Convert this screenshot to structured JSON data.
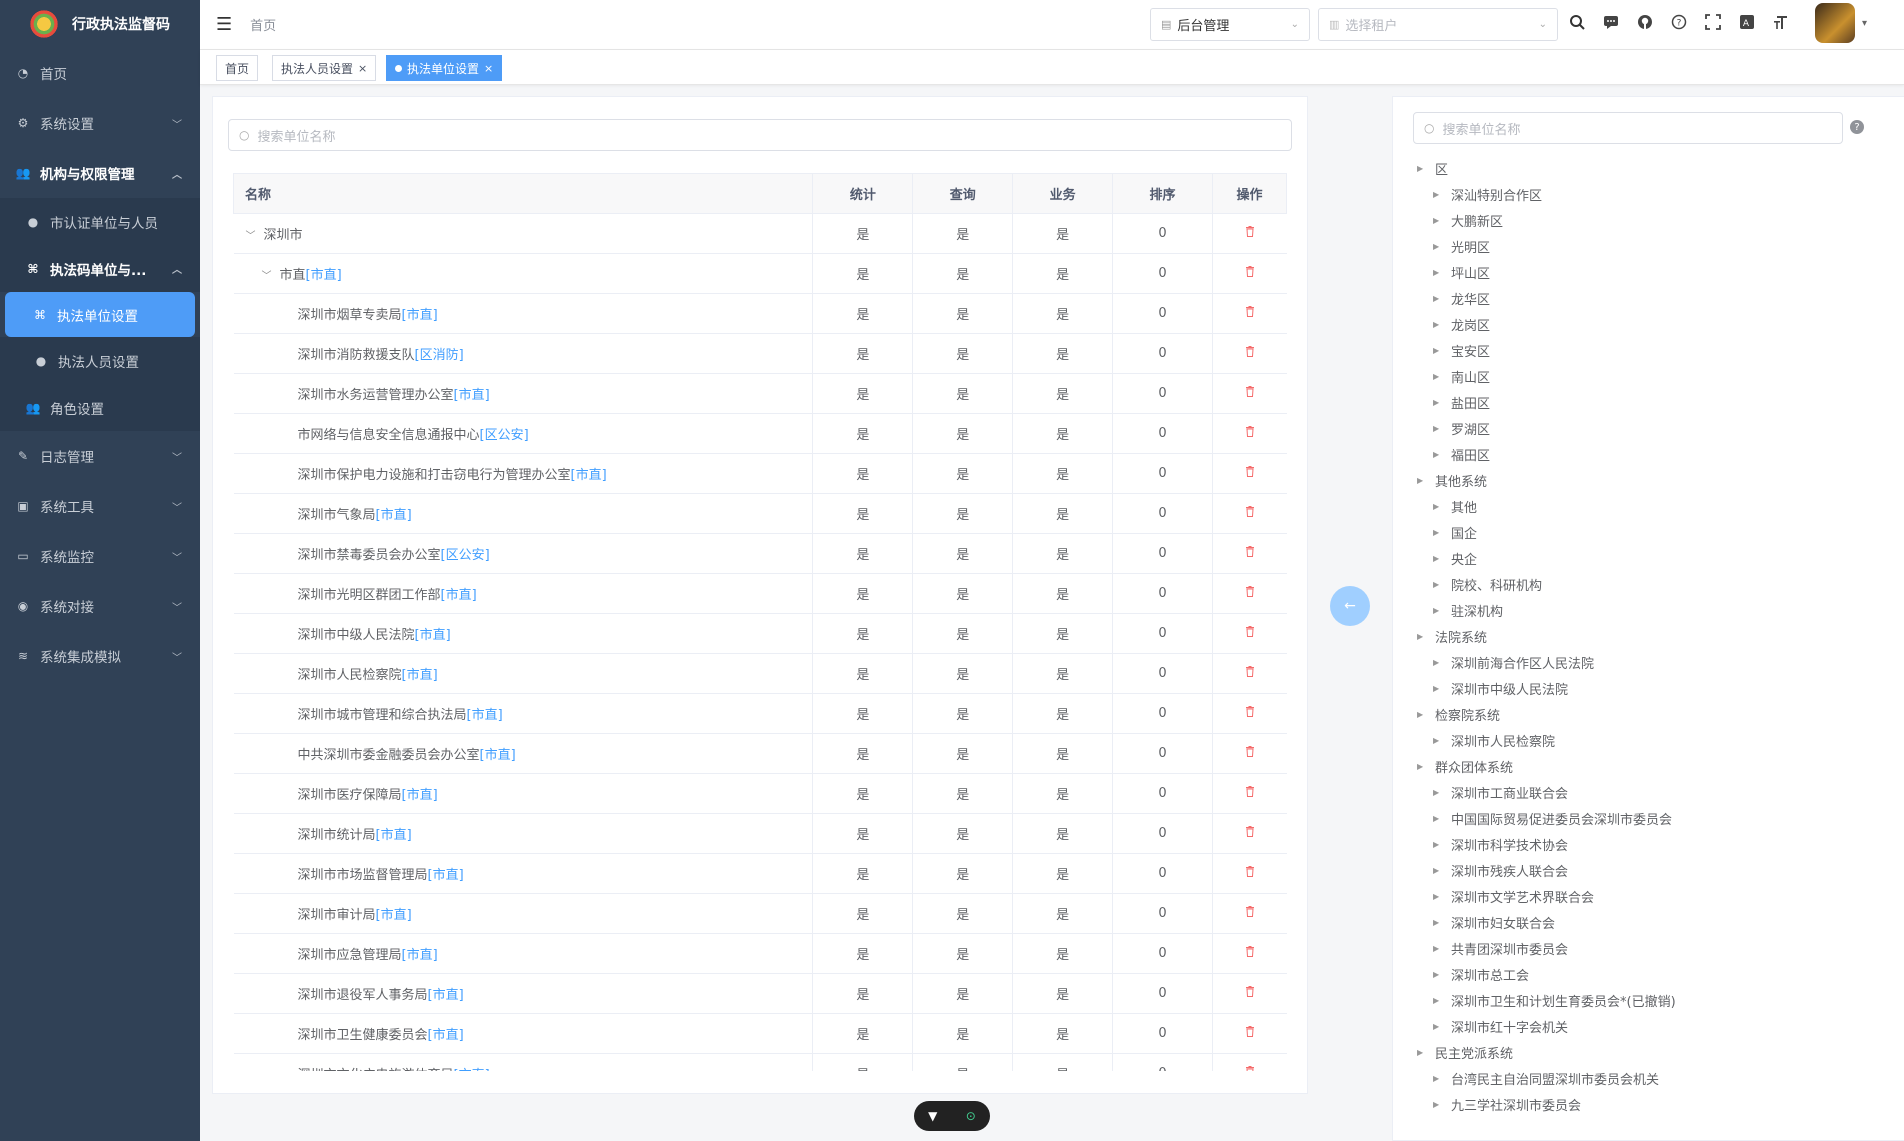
{
  "app": {
    "title": "行政执法监督码"
  },
  "sidebar": {
    "items": [
      {
        "label": "首页",
        "icon": "dashboard-icon",
        "type": "top"
      },
      {
        "label": "系统设置",
        "icon": "gear-icon",
        "type": "top",
        "chev": "down"
      },
      {
        "label": "机构与权限管理",
        "icon": "users-icon",
        "type": "top",
        "chev": "up",
        "bold": true
      },
      {
        "label": "市认证单位与人员",
        "icon": "user-icon",
        "type": "sub"
      },
      {
        "label": "执法码单位与...",
        "icon": "tree-icon",
        "type": "sub",
        "chev": "up",
        "bold": true
      },
      {
        "label": "执法单位设置",
        "icon": "tree-icon",
        "type": "active"
      },
      {
        "label": "执法人员设置",
        "icon": "user-icon",
        "type": "sub2"
      },
      {
        "label": "角色设置",
        "icon": "users-icon",
        "type": "sub"
      },
      {
        "label": "日志管理",
        "icon": "edit-icon",
        "type": "top",
        "chev": "down"
      },
      {
        "label": "系统工具",
        "icon": "briefcase-icon",
        "type": "top",
        "chev": "down"
      },
      {
        "label": "系统监控",
        "icon": "monitor-icon",
        "type": "top",
        "chev": "down"
      },
      {
        "label": "系统对接",
        "icon": "globe-icon",
        "type": "top",
        "chev": "down"
      },
      {
        "label": "系统集成模拟",
        "icon": "layers-icon",
        "type": "top",
        "chev": "down"
      }
    ]
  },
  "header": {
    "breadcrumb": "首页",
    "backend_select": "后台管理",
    "tenant_placeholder": "选择租户"
  },
  "tags": [
    {
      "label": "首页",
      "active": false,
      "closable": false
    },
    {
      "label": "执法人员设置",
      "active": false,
      "closable": true
    },
    {
      "label": "执法单位设置",
      "active": true,
      "closable": true
    }
  ],
  "left": {
    "search_placeholder": "搜索单位名称",
    "columns": [
      "名称",
      "统计",
      "查询",
      "业务",
      "排序",
      "操作"
    ],
    "rows": [
      {
        "name": "深圳市",
        "suffix": "",
        "level": 0,
        "expand": true,
        "stat": "是",
        "query": "是",
        "biz": "是",
        "sort": "0"
      },
      {
        "name": "市直",
        "suffix": "[市直]",
        "level": 1,
        "expand": true,
        "stat": "是",
        "query": "是",
        "biz": "是",
        "sort": "0"
      },
      {
        "name": "深圳市烟草专卖局",
        "suffix": "[市直]",
        "level": 2,
        "stat": "是",
        "query": "是",
        "biz": "是",
        "sort": "0"
      },
      {
        "name": "深圳市消防救援支队",
        "suffix": "[区消防]",
        "level": 2,
        "stat": "是",
        "query": "是",
        "biz": "是",
        "sort": "0"
      },
      {
        "name": "深圳市水务运营管理办公室",
        "suffix": "[市直]",
        "level": 2,
        "stat": "是",
        "query": "是",
        "biz": "是",
        "sort": "0"
      },
      {
        "name": "市网络与信息安全信息通报中心",
        "suffix": "[区公安]",
        "level": 2,
        "stat": "是",
        "query": "是",
        "biz": "是",
        "sort": "0"
      },
      {
        "name": "深圳市保护电力设施和打击窃电行为管理办公室",
        "suffix": "[市直]",
        "level": 2,
        "stat": "是",
        "query": "是",
        "biz": "是",
        "sort": "0"
      },
      {
        "name": "深圳市气象局",
        "suffix": "[市直]",
        "level": 2,
        "stat": "是",
        "query": "是",
        "biz": "是",
        "sort": "0"
      },
      {
        "name": "深圳市禁毒委员会办公室",
        "suffix": "[区公安]",
        "level": 2,
        "stat": "是",
        "query": "是",
        "biz": "是",
        "sort": "0"
      },
      {
        "name": "深圳市光明区群团工作部",
        "suffix": "[市直]",
        "level": 2,
        "stat": "是",
        "query": "是",
        "biz": "是",
        "sort": "0"
      },
      {
        "name": "深圳市中级人民法院",
        "suffix": "[市直]",
        "level": 2,
        "stat": "是",
        "query": "是",
        "biz": "是",
        "sort": "0"
      },
      {
        "name": "深圳市人民检察院",
        "suffix": "[市直]",
        "level": 2,
        "stat": "是",
        "query": "是",
        "biz": "是",
        "sort": "0"
      },
      {
        "name": "深圳市城市管理和综合执法局",
        "suffix": "[市直]",
        "level": 2,
        "stat": "是",
        "query": "是",
        "biz": "是",
        "sort": "0"
      },
      {
        "name": "中共深圳市委金融委员会办公室",
        "suffix": "[市直]",
        "level": 2,
        "stat": "是",
        "query": "是",
        "biz": "是",
        "sort": "0"
      },
      {
        "name": "深圳市医疗保障局",
        "suffix": "[市直]",
        "level": 2,
        "stat": "是",
        "query": "是",
        "biz": "是",
        "sort": "0"
      },
      {
        "name": "深圳市统计局",
        "suffix": "[市直]",
        "level": 2,
        "stat": "是",
        "query": "是",
        "biz": "是",
        "sort": "0"
      },
      {
        "name": "深圳市市场监督管理局",
        "suffix": "[市直]",
        "level": 2,
        "stat": "是",
        "query": "是",
        "biz": "是",
        "sort": "0"
      },
      {
        "name": "深圳市审计局",
        "suffix": "[市直]",
        "level": 2,
        "stat": "是",
        "query": "是",
        "biz": "是",
        "sort": "0"
      },
      {
        "name": "深圳市应急管理局",
        "suffix": "[市直]",
        "level": 2,
        "stat": "是",
        "query": "是",
        "biz": "是",
        "sort": "0"
      },
      {
        "name": "深圳市退役军人事务局",
        "suffix": "[市直]",
        "level": 2,
        "stat": "是",
        "query": "是",
        "biz": "是",
        "sort": "0"
      },
      {
        "name": "深圳市卫生健康委员会",
        "suffix": "[市直]",
        "level": 2,
        "stat": "是",
        "query": "是",
        "biz": "是",
        "sort": "0"
      },
      {
        "name": "深圳市文化广电旅游体育局",
        "suffix": "[市直]",
        "level": 2,
        "stat": "是",
        "query": "是",
        "biz": "是",
        "sort": "0"
      }
    ]
  },
  "right": {
    "search_placeholder": "搜索单位名称",
    "tree": [
      {
        "label": "区",
        "level": 0
      },
      {
        "label": "深汕特别合作区",
        "level": 1
      },
      {
        "label": "大鹏新区",
        "level": 1
      },
      {
        "label": "光明区",
        "level": 1
      },
      {
        "label": "坪山区",
        "level": 1
      },
      {
        "label": "龙华区",
        "level": 1
      },
      {
        "label": "龙岗区",
        "level": 1
      },
      {
        "label": "宝安区",
        "level": 1
      },
      {
        "label": "南山区",
        "level": 1
      },
      {
        "label": "盐田区",
        "level": 1
      },
      {
        "label": "罗湖区",
        "level": 1
      },
      {
        "label": "福田区",
        "level": 1
      },
      {
        "label": "其他系统",
        "level": 0
      },
      {
        "label": "其他",
        "level": 1
      },
      {
        "label": "国企",
        "level": 1
      },
      {
        "label": "央企",
        "level": 1
      },
      {
        "label": "院校、科研机构",
        "level": 1
      },
      {
        "label": "驻深机构",
        "level": 1
      },
      {
        "label": "法院系统",
        "level": 0
      },
      {
        "label": "深圳前海合作区人民法院",
        "level": 1
      },
      {
        "label": "深圳市中级人民法院",
        "level": 1
      },
      {
        "label": "检察院系统",
        "level": 0
      },
      {
        "label": "深圳市人民检察院",
        "level": 1
      },
      {
        "label": "群众团体系统",
        "level": 0
      },
      {
        "label": "深圳市工商业联合会",
        "level": 1
      },
      {
        "label": "中国国际贸易促进委员会深圳市委员会",
        "level": 1
      },
      {
        "label": "深圳市科学技术协会",
        "level": 1
      },
      {
        "label": "深圳市残疾人联合会",
        "level": 1
      },
      {
        "label": "深圳市文学艺术界联合会",
        "level": 1
      },
      {
        "label": "深圳市妇女联合会",
        "level": 1
      },
      {
        "label": "共青团深圳市委员会",
        "level": 1
      },
      {
        "label": "深圳市总工会",
        "level": 1
      },
      {
        "label": "深圳市卫生和计划生育委员会*(已撤销)",
        "level": 1
      },
      {
        "label": "深圳市红十字会机关",
        "level": 1
      },
      {
        "label": "民主党派系统",
        "level": 0
      },
      {
        "label": "台湾民主自治同盟深圳市委员会机关",
        "level": 1
      },
      {
        "label": "九三学社深圳市委员会",
        "level": 1
      }
    ]
  },
  "colors": {
    "sidebar_bg": "#304156",
    "accent": "#4e9cf7",
    "link": "#409eff",
    "danger": "#f56c6c"
  }
}
